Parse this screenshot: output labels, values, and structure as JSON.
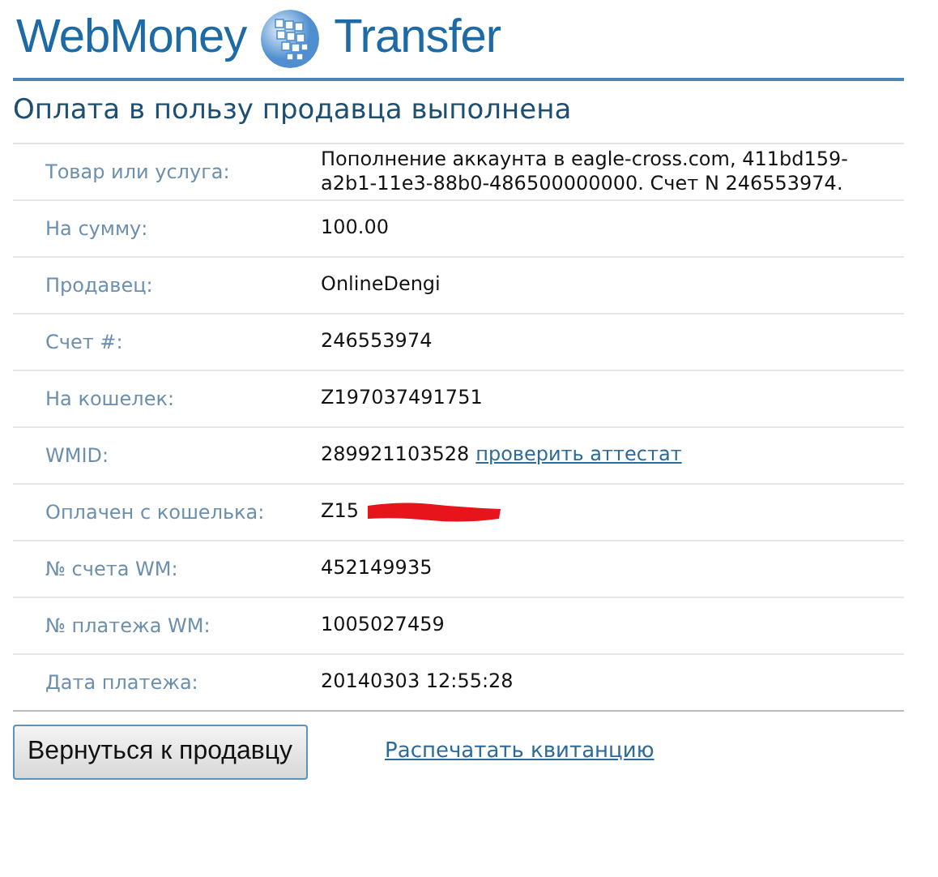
{
  "header": {
    "brand_left": "WebMoney",
    "brand_right": "Transfer"
  },
  "title": "Оплата в пользу продавца выполнена",
  "rows": [
    {
      "label": "Товар или услуга:",
      "value": "Пополнение аккаунта в eagle-cross.com, 411bd159-a2b1-11e3-88b0-486500000000. Счет N 246553974."
    },
    {
      "label": "На сумму:",
      "value": "100.00"
    },
    {
      "label": "Продавец:",
      "value": "OnlineDengi"
    },
    {
      "label": "Счет #:",
      "value": "246553974"
    },
    {
      "label": "На кошелек:",
      "value": "Z197037491751"
    },
    {
      "label": "WMID:",
      "value": "289921103528",
      "link": "проверить аттестат"
    },
    {
      "label": "Оплачен с кошелька:",
      "value": "Z15",
      "redacted": true
    },
    {
      "label": "№ счета WM:",
      "value": "452149935"
    },
    {
      "label": "№ платежа WM:",
      "value": "1005027459"
    },
    {
      "label": "Дата платежа:",
      "value": "20140303 12:55:28"
    }
  ],
  "actions": {
    "button": "Вернуться к продавцу",
    "link": "Распечатать квитанцию"
  }
}
